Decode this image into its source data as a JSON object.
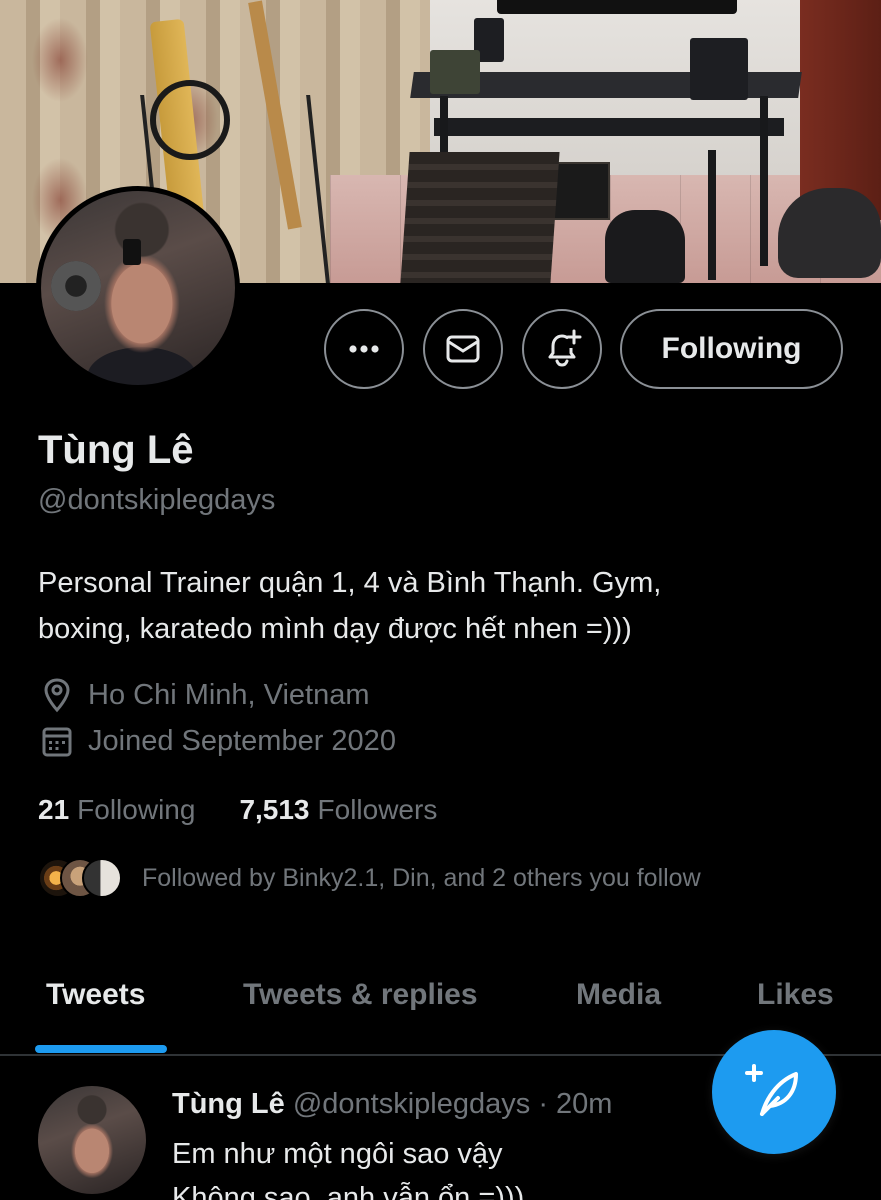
{
  "profile": {
    "name": "Tùng Lê",
    "handle": "@dontskiplegdays",
    "bio_line1": "Personal Trainer quận 1, 4 và Bình Thạnh. Gym,",
    "bio_line2": "boxing, karatedo mình dạy được hết nhen =)))",
    "location": "Ho Chi Minh, Vietnam",
    "joined": "Joined September 2020",
    "following_count": "21",
    "following_label": "Following",
    "followers_count": "7,513",
    "followers_label": "Followers",
    "followed_by": "Followed by Binky2.1, Din, and 2 others you follow"
  },
  "actions": {
    "more_icon": "more-icon",
    "message_icon": "mail-icon",
    "notify_icon": "bell-plus-icon",
    "following_button": "Following"
  },
  "tabs": [
    {
      "label": "Tweets",
      "active": true
    },
    {
      "label": "Tweets & replies",
      "active": false
    },
    {
      "label": "Media",
      "active": false
    },
    {
      "label": "Likes",
      "active": false
    }
  ],
  "tweet": {
    "name": "Tùng Lê",
    "handle": "@dontskiplegdays",
    "separator": "·",
    "time": "20m",
    "line1": "Em như một ngôi sao vậy",
    "line2": "Không sao, anh vẫn ổn =)))",
    "more": "·"
  },
  "fab": {
    "icon": "compose-tweet-icon"
  },
  "colors": {
    "background": "#000000",
    "text_primary": "#e7e9ea",
    "text_secondary": "#71767b",
    "accent": "#1d9bf0",
    "border": "#8b9096"
  }
}
